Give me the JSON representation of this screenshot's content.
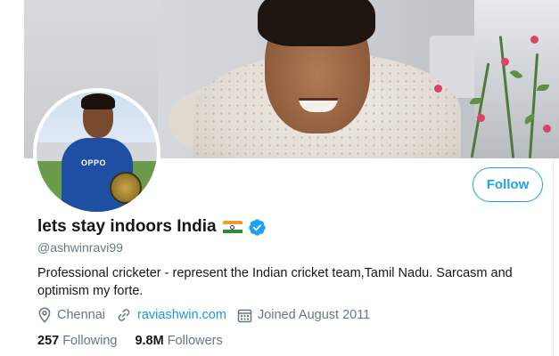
{
  "profile": {
    "display_name": "lets stay indoors India",
    "handle": "@ashwinravi99",
    "bio": "Professional cricketer - represent the Indian cricket team,Tamil Nadu. Sarcasm and optimism my forte.",
    "location": "Chennai",
    "website": "raviashwin.com",
    "joined": "Joined August 2011",
    "following_count": "257",
    "following_label": "Following",
    "followers_count": "9.8M",
    "followers_label": "Followers"
  },
  "actions": {
    "follow_label": "Follow"
  },
  "icons": {
    "location": "location-pin-icon",
    "website": "link-icon",
    "joined": "calendar-icon",
    "verified": "verified-badge-icon",
    "flag": "india-flag-emoji"
  },
  "colors": {
    "accent": "#1da1f2",
    "link": "#1b95e0",
    "secondary_text": "#657786",
    "primary_text": "#14171a",
    "flag_saffron": "#f29a2e",
    "flag_green": "#2e8b3a"
  }
}
